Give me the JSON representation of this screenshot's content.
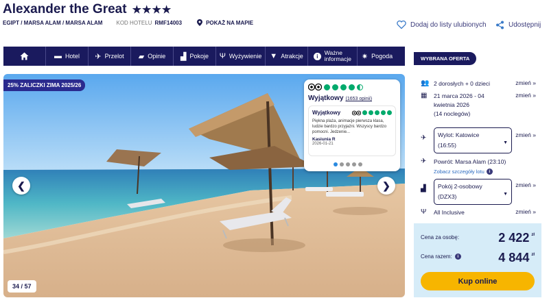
{
  "hotel": {
    "name": "Alexander the Great",
    "stars": "★★★★",
    "location": "EGIPT / MARSA ALAM / MARSA ALAM",
    "code_label": "KOD HOTELU",
    "code": "RMF14003",
    "map_label": "POKAŻ NA MAPIE"
  },
  "actions": {
    "favorite": "Dodaj do listy ulubionych",
    "share": "Udostępnij"
  },
  "nav": {
    "home_icon": "home-icon",
    "items": [
      {
        "label": "Hotel",
        "icon": "bed-icon"
      },
      {
        "label": "Przelot",
        "icon": "plane-icon"
      },
      {
        "label": "Opinie",
        "icon": "speech-bubble-icon"
      },
      {
        "label": "Pokoje",
        "icon": "sofa-icon"
      },
      {
        "label": "Wyżywienie",
        "icon": "cutlery-icon"
      },
      {
        "label": "Atrakcje",
        "icon": "cocktail-icon"
      },
      {
        "label": "Ważne informacje",
        "line1": "Ważne",
        "line2": "informacje",
        "icon": "info-icon"
      },
      {
        "label": "Pogoda",
        "icon": "sun-icon"
      }
    ]
  },
  "gallery": {
    "promo": "25% ZALICZKI ZIMA 2025/26",
    "counter": "34 / 57",
    "prev_icon": "chevron-left-icon",
    "next_icon": "chevron-right-icon"
  },
  "tripadvisor": {
    "rating_label": "Wyjątkowy",
    "rating_value": 4.5,
    "review_count": "(1653 opinii)",
    "review": {
      "title": "Wyjątkowy",
      "rating_value": 5,
      "text": "Piękna plaża, animacje pierwsza klasa, ludzie bardzo przyjaźni. Wszyscy bardzo pomocni. Jedzenie...",
      "author": "Kasiunia R",
      "date": "2026-01-21"
    },
    "pager": {
      "total": 5,
      "active": 1
    }
  },
  "offer": {
    "label": "WYBRANA OFERTA",
    "change_label": "zmień »",
    "travelers": "2 dorosłych + 0 dzieci",
    "dates_line1": "21 marca 2026 - 04",
    "dates_line2": "kwietnia 2026",
    "dates_line3": "(14 noclegów)",
    "departure_line1": "Wylot: Katowice",
    "departure_line2": "(16:55)",
    "return": "Powrót: Marsa Alam (23:10)",
    "flight_details": "Zobacz szczegóły lotu",
    "room_line1": "Pokój 2-osobowy",
    "room_line2": "(DZX3)",
    "board": "All Inclusive"
  },
  "price": {
    "per_person_label": "Cena za osobę:",
    "per_person": "2 422",
    "total_label": "Cena razem:",
    "total": "4 844",
    "currency": "zł",
    "buy_label": "Kup online"
  }
}
